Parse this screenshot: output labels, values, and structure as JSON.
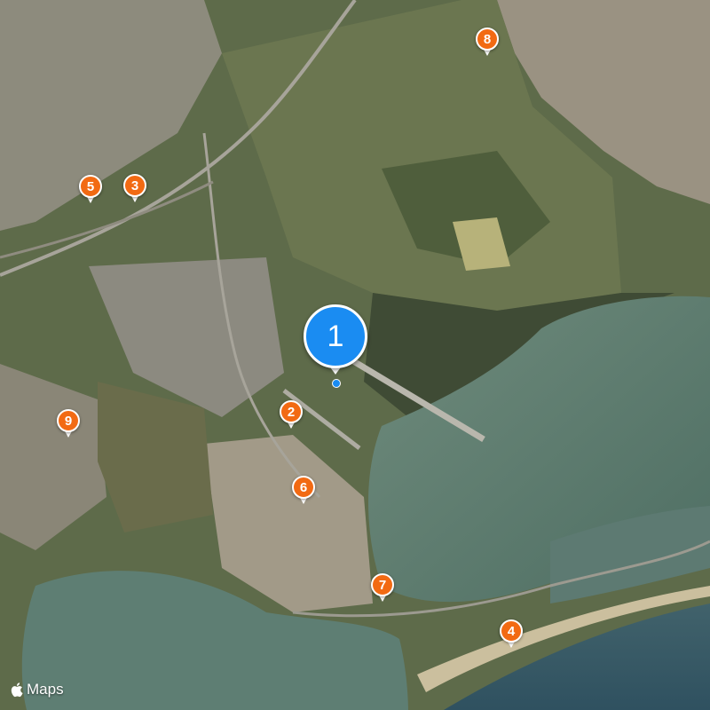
{
  "map": {
    "type": "satellite",
    "main_marker": {
      "label": "1",
      "color": "#1a8cf2"
    },
    "markers": [
      {
        "label": "2",
        "color": "#f26a13"
      },
      {
        "label": "3",
        "color": "#f26a13"
      },
      {
        "label": "4",
        "color": "#f26a13"
      },
      {
        "label": "5",
        "color": "#f26a13"
      },
      {
        "label": "6",
        "color": "#f26a13"
      },
      {
        "label": "7",
        "color": "#f26a13"
      },
      {
        "label": "8",
        "color": "#f26a13"
      },
      {
        "label": "9",
        "color": "#f26a13"
      }
    ]
  },
  "attribution": {
    "logo_icon": "apple-logo-icon",
    "text": "Maps"
  }
}
